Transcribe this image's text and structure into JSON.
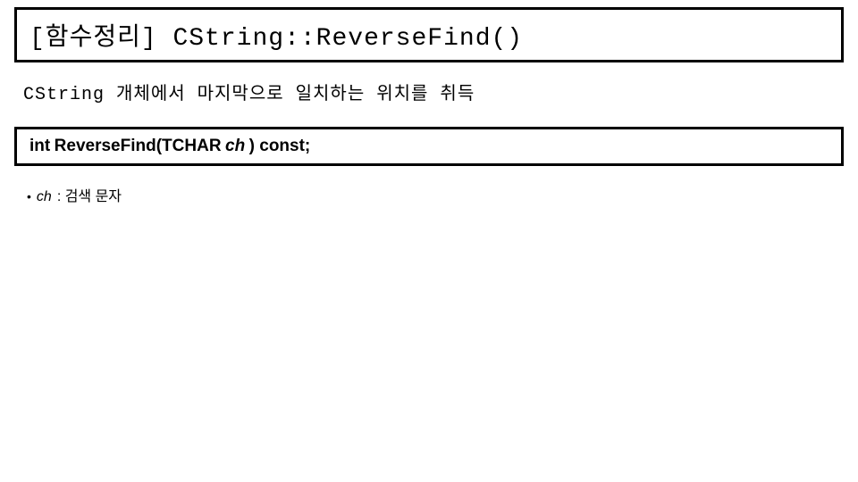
{
  "title": "[함수정리] CString::ReverseFind()",
  "description": "CString 개체에서 마지막으로 일치하는 위치를 취득",
  "signature": {
    "return_type": "int",
    "name": "ReverseFind(TCHAR",
    "param": "ch",
    "tail": " ) const;"
  },
  "params": [
    {
      "name": "ch",
      "desc": "  : 검색 문자"
    }
  ]
}
